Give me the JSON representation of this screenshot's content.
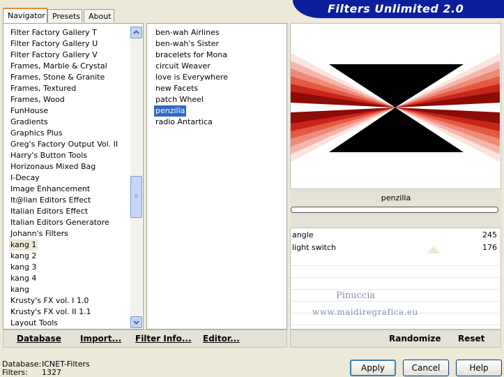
{
  "tabs": [
    "Navigator",
    "Presets",
    "About"
  ],
  "banner_title": "Filters Unlimited 2.0",
  "categories": [
    "Filter Factory Gallery T",
    "Filter Factory Gallery U",
    "Filter Factory Gallery V",
    "Frames, Marble & Crystal",
    "Frames, Stone & Granite",
    "Frames, Textured",
    "Frames, Wood",
    "FunHouse",
    "Gradients",
    "Graphics Plus",
    "Greg's Factory Output Vol. II",
    "Harry's Button Tools",
    "Horizonaus Mixed Bag",
    "I-Decay",
    "Image Enhancement",
    "It@lian Editors Effect",
    "Italian Editors Effect",
    "Italian Editors Generatore",
    "Johann's Filters",
    "kang 1",
    "kang 2",
    "kang 3",
    "kang 4",
    "kang",
    "Krusty's FX vol. I 1.0",
    "Krusty's FX vol. II 1.1",
    "Layout Tools"
  ],
  "selected_category": "kang 1",
  "filters": [
    "ben-wah Airlines",
    "ben-wah's Sister",
    "bracelets for Mona",
    "circuit Weaver",
    "love is Everywhere",
    "new Facets",
    "patch Wheel",
    "penzilla",
    "radio Antartica"
  ],
  "selected_filter": "penzilla",
  "preview": {
    "filter_name": "penzilla",
    "progress": 0
  },
  "params": [
    {
      "label": "angle",
      "value": "245"
    },
    {
      "label": "light switch",
      "value": "176"
    }
  ],
  "watermark": {
    "line1": "Pinuccia",
    "line2": "www.maidiregrafica.eu"
  },
  "bottom_buttons": {
    "database": "Database",
    "import": "Import...",
    "filter_info": "Filter Info...",
    "editor": "Editor...",
    "randomize": "Randomize",
    "reset": "Reset"
  },
  "status": {
    "database_label": "Database:",
    "database_value": "ICNET-Filters",
    "filters_label": "Filters:",
    "filters_value": "1327"
  },
  "dialog_buttons": {
    "apply": "Apply",
    "cancel": "Cancel",
    "help": "Help"
  },
  "colors": {
    "selection": "#316ac5",
    "banner": "#0b1f9c",
    "tab_accent": "#e68b2c"
  }
}
